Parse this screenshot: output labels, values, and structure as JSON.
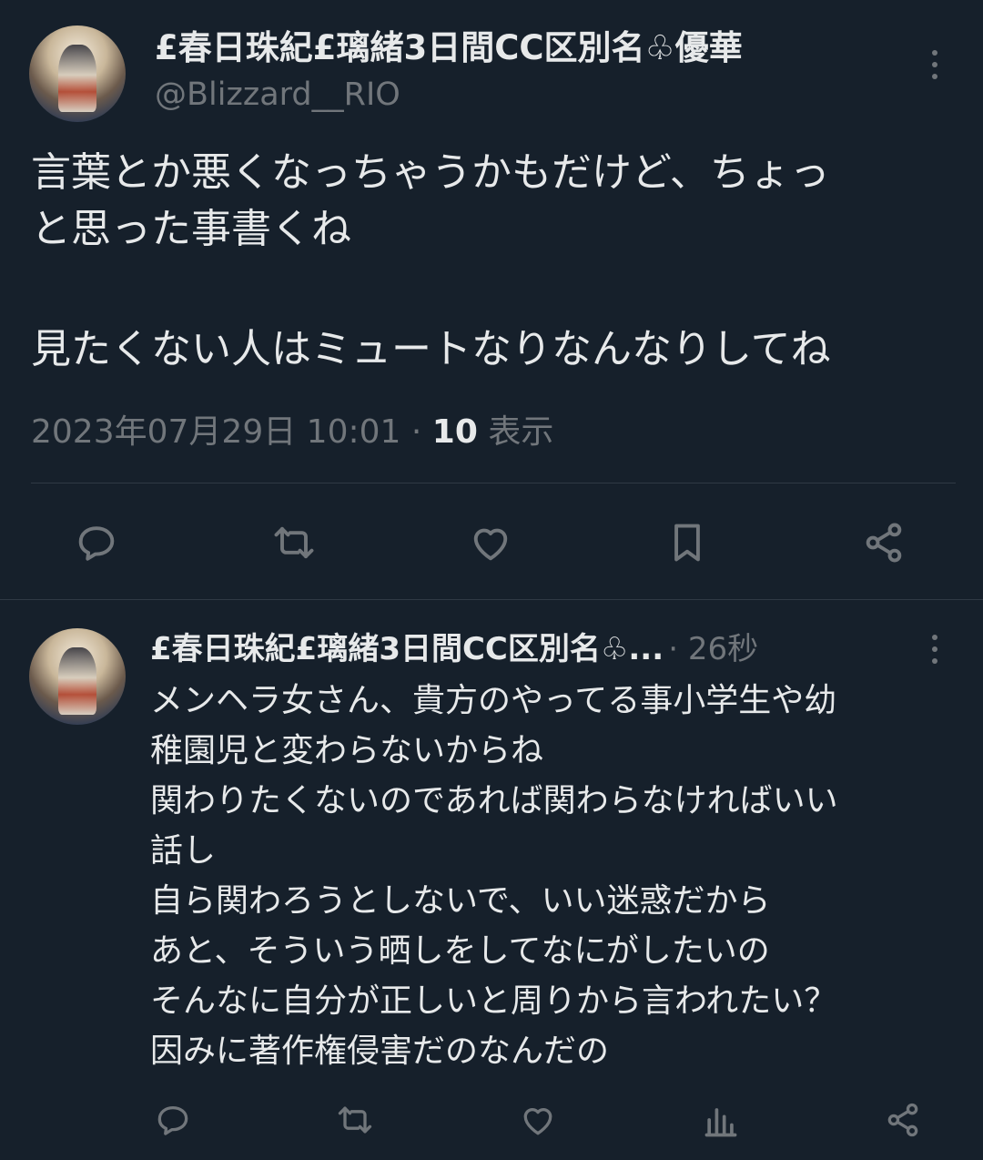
{
  "main_tweet": {
    "display_name": "£春日珠紀£璃緒3日間CC区別名♧優華",
    "handle": "@Blizzard__RIO",
    "text_line1": "言葉とか悪くなっちゃうかもだけど、ちょっ",
    "text_line2": "と思った事書くね",
    "text_line3": "見たくない人はミュートなりなんなりしてね",
    "timestamp": "2023年07月29日 10:01",
    "separator": "·",
    "views_count": "10",
    "views_label": "表示",
    "actions": [
      "reply-icon",
      "retweet-icon",
      "like-icon",
      "bookmark-icon",
      "share-icon"
    ]
  },
  "reply_tweet": {
    "display_name": "£春日珠紀£璃緒3日間CC区別名♧...",
    "time_ago": "· 26秒",
    "text": "メンヘラ女さん、貴方のやってる事小学生や幼\n稚園児と変わらないからね\n関わりたくないのであれば関わらなければいい\n話し\n自ら関わろうとしないで、いい迷惑だから\nあと、そういう晒しをしてなにがしたいの\nそんなに自分が正しいと周りから言われたい？\n因みに著作権侵害だのなんだの",
    "actions": [
      "reply-icon",
      "retweet-icon",
      "like-icon",
      "analytics-icon",
      "share-icon"
    ]
  },
  "colors": {
    "background": "#16202b",
    "text": "#e7e9ea",
    "secondary": "#71767b",
    "divider": "#2f3a45"
  }
}
